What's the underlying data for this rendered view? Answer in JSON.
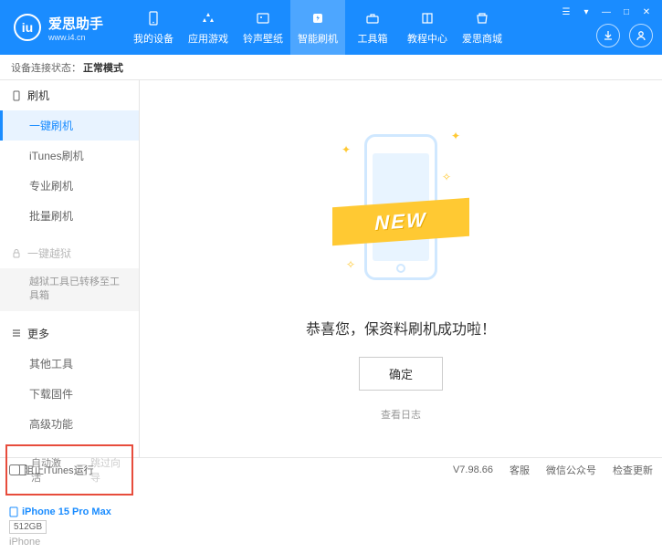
{
  "header": {
    "logo_title": "爱思助手",
    "logo_sub": "www.i4.cn"
  },
  "nav": [
    {
      "label": "我的设备"
    },
    {
      "label": "应用游戏"
    },
    {
      "label": "铃声壁纸"
    },
    {
      "label": "智能刷机"
    },
    {
      "label": "工具箱"
    },
    {
      "label": "教程中心"
    },
    {
      "label": "爱思商城"
    }
  ],
  "status": {
    "label": "设备连接状态：",
    "value": "正常模式"
  },
  "sidebar": {
    "sec_flash": "刷机",
    "items_flash": [
      "一键刷机",
      "iTunes刷机",
      "专业刷机",
      "批量刷机"
    ],
    "sec_jailbreak": "一键越狱",
    "jailbreak_note": "越狱工具已转移至工具箱",
    "sec_more": "更多",
    "items_more": [
      "其他工具",
      "下载固件",
      "高级功能"
    ],
    "chk_auto": "自动激活",
    "chk_skip": "跳过向导"
  },
  "device": {
    "name": "iPhone 15 Pro Max",
    "capacity": "512GB",
    "type": "iPhone"
  },
  "main": {
    "ribbon": "NEW",
    "success": "恭喜您，保资料刷机成功啦！",
    "ok": "确定",
    "log": "查看日志"
  },
  "footer": {
    "block_itunes": "阻止iTunes运行",
    "version": "V7.98.66",
    "support": "客服",
    "wechat": "微信公众号",
    "update": "检查更新"
  }
}
